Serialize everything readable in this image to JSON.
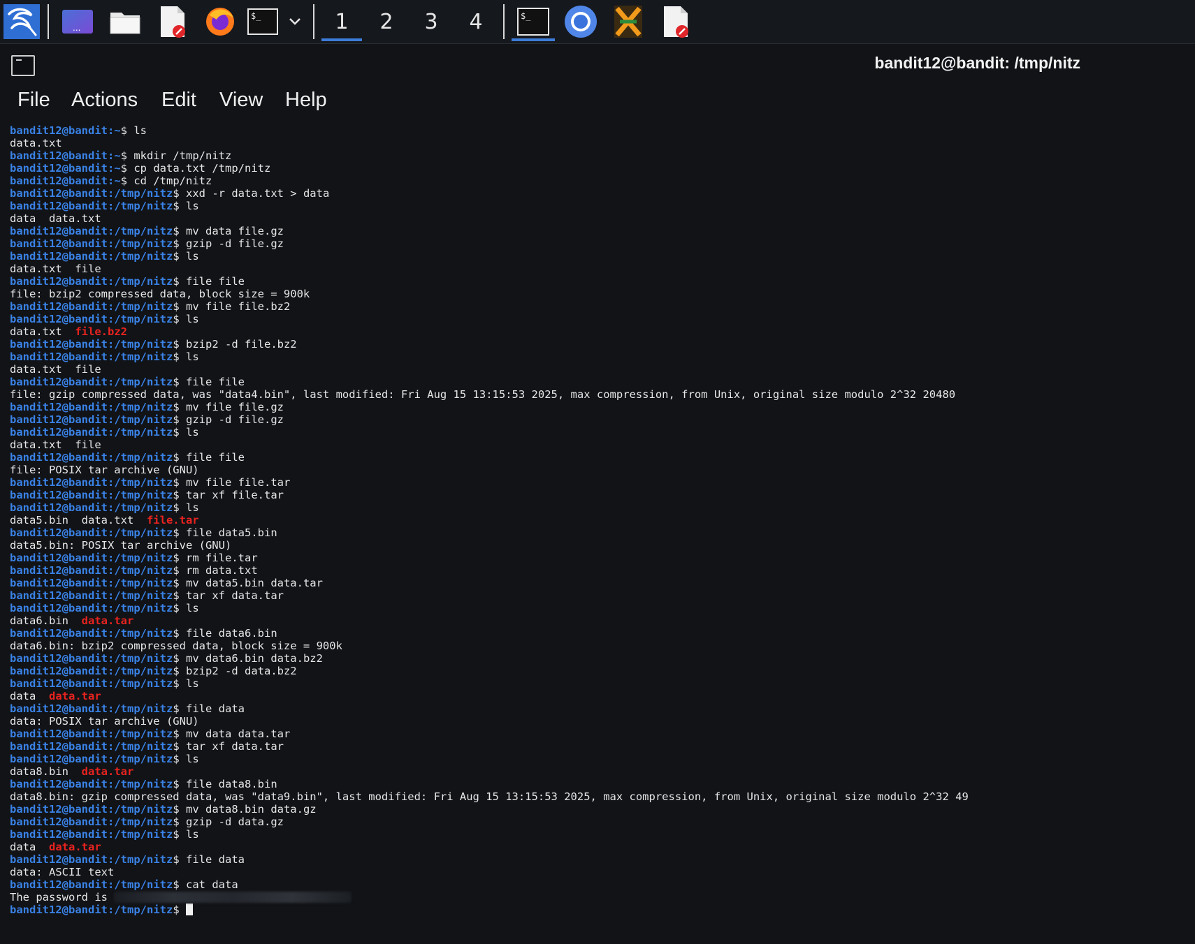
{
  "taskbar": {
    "workspaces": [
      "1",
      "2",
      "3",
      "4"
    ],
    "active_workspace": "1",
    "apps": [
      "kali-menu-icon",
      "desktop-icon",
      "file-manager-icon",
      "text-editor-icon",
      "firefox-icon",
      "terminal-icon",
      "chevron-down-icon",
      "terminal-icon",
      "chromium-icon",
      "burp-icon",
      "text-editor-icon"
    ]
  },
  "window": {
    "title": "bandit12@bandit: /tmp/nitz"
  },
  "menu": {
    "items": [
      "File",
      "Actions",
      "Edit",
      "View",
      "Help"
    ]
  },
  "terminal": {
    "user": "bandit12@bandit",
    "lines": [
      {
        "type": "prompt",
        "path": "~",
        "cmd": "ls"
      },
      {
        "type": "out",
        "text": "data.txt"
      },
      {
        "type": "prompt",
        "path": "~",
        "cmd": "mkdir /tmp/nitz"
      },
      {
        "type": "prompt",
        "path": "~",
        "cmd": "cp data.txt /tmp/nitz"
      },
      {
        "type": "prompt",
        "path": "~",
        "cmd": "cd /tmp/nitz"
      },
      {
        "type": "prompt",
        "path": "/tmp/nitz",
        "cmd": "xxd -r data.txt > data"
      },
      {
        "type": "prompt",
        "path": "/tmp/nitz",
        "cmd": "ls"
      },
      {
        "type": "out",
        "text": "data  data.txt"
      },
      {
        "type": "prompt",
        "path": "/tmp/nitz",
        "cmd": "mv data file.gz"
      },
      {
        "type": "prompt",
        "path": "/tmp/nitz",
        "cmd": "gzip -d file.gz"
      },
      {
        "type": "prompt",
        "path": "/tmp/nitz",
        "cmd": "ls"
      },
      {
        "type": "out",
        "text": "data.txt  file"
      },
      {
        "type": "prompt",
        "path": "/tmp/nitz",
        "cmd": "file file"
      },
      {
        "type": "out",
        "text": "file: bzip2 compressed data, block size = 900k"
      },
      {
        "type": "prompt",
        "path": "/tmp/nitz",
        "cmd": "mv file file.bz2"
      },
      {
        "type": "prompt",
        "path": "/tmp/nitz",
        "cmd": "ls"
      },
      {
        "type": "ls",
        "plain": "data.txt  ",
        "archive": "file.bz2"
      },
      {
        "type": "prompt",
        "path": "/tmp/nitz",
        "cmd": "bzip2 -d file.bz2"
      },
      {
        "type": "prompt",
        "path": "/tmp/nitz",
        "cmd": "ls"
      },
      {
        "type": "out",
        "text": "data.txt  file"
      },
      {
        "type": "prompt",
        "path": "/tmp/nitz",
        "cmd": "file file"
      },
      {
        "type": "out",
        "text": "file: gzip compressed data, was \"data4.bin\", last modified: Fri Aug 15 13:15:53 2025, max compression, from Unix, original size modulo 2^32 20480"
      },
      {
        "type": "prompt",
        "path": "/tmp/nitz",
        "cmd": "mv file file.gz"
      },
      {
        "type": "prompt",
        "path": "/tmp/nitz",
        "cmd": "gzip -d file.gz"
      },
      {
        "type": "prompt",
        "path": "/tmp/nitz",
        "cmd": "ls"
      },
      {
        "type": "out",
        "text": "data.txt  file"
      },
      {
        "type": "prompt",
        "path": "/tmp/nitz",
        "cmd": "file file"
      },
      {
        "type": "out",
        "text": "file: POSIX tar archive (GNU)"
      },
      {
        "type": "prompt",
        "path": "/tmp/nitz",
        "cmd": "mv file file.tar"
      },
      {
        "type": "prompt",
        "path": "/tmp/nitz",
        "cmd": "tar xf file.tar"
      },
      {
        "type": "prompt",
        "path": "/tmp/nitz",
        "cmd": "ls"
      },
      {
        "type": "ls",
        "plain": "data5.bin  data.txt  ",
        "archive": "file.tar"
      },
      {
        "type": "prompt",
        "path": "/tmp/nitz",
        "cmd": "file data5.bin"
      },
      {
        "type": "out",
        "text": "data5.bin: POSIX tar archive (GNU)"
      },
      {
        "type": "prompt",
        "path": "/tmp/nitz",
        "cmd": "rm file.tar"
      },
      {
        "type": "prompt",
        "path": "/tmp/nitz",
        "cmd": "rm data.txt"
      },
      {
        "type": "prompt",
        "path": "/tmp/nitz",
        "cmd": "mv data5.bin data.tar"
      },
      {
        "type": "prompt",
        "path": "/tmp/nitz",
        "cmd": "tar xf data.tar"
      },
      {
        "type": "prompt",
        "path": "/tmp/nitz",
        "cmd": "ls"
      },
      {
        "type": "ls",
        "plain": "data6.bin  ",
        "archive": "data.tar"
      },
      {
        "type": "prompt",
        "path": "/tmp/nitz",
        "cmd": "file data6.bin"
      },
      {
        "type": "out",
        "text": "data6.bin: bzip2 compressed data, block size = 900k"
      },
      {
        "type": "prompt",
        "path": "/tmp/nitz",
        "cmd": "mv data6.bin data.bz2"
      },
      {
        "type": "prompt",
        "path": "/tmp/nitz",
        "cmd": "bzip2 -d data.bz2"
      },
      {
        "type": "prompt",
        "path": "/tmp/nitz",
        "cmd": "ls"
      },
      {
        "type": "ls",
        "plain": "data  ",
        "archive": "data.tar"
      },
      {
        "type": "prompt",
        "path": "/tmp/nitz",
        "cmd": "file data"
      },
      {
        "type": "out",
        "text": "data: POSIX tar archive (GNU)"
      },
      {
        "type": "prompt",
        "path": "/tmp/nitz",
        "cmd": "mv data data.tar"
      },
      {
        "type": "prompt",
        "path": "/tmp/nitz",
        "cmd": "tar xf data.tar"
      },
      {
        "type": "prompt",
        "path": "/tmp/nitz",
        "cmd": "ls"
      },
      {
        "type": "ls",
        "plain": "data8.bin  ",
        "archive": "data.tar"
      },
      {
        "type": "prompt",
        "path": "/tmp/nitz",
        "cmd": "file data8.bin"
      },
      {
        "type": "out",
        "text": "data8.bin: gzip compressed data, was \"data9.bin\", last modified: Fri Aug 15 13:15:53 2025, max compression, from Unix, original size modulo 2^32 49"
      },
      {
        "type": "prompt",
        "path": "/tmp/nitz",
        "cmd": "mv data8.bin data.gz"
      },
      {
        "type": "prompt",
        "path": "/tmp/nitz",
        "cmd": "gzip -d data.gz"
      },
      {
        "type": "prompt",
        "path": "/tmp/nitz",
        "cmd": "ls"
      },
      {
        "type": "ls",
        "plain": "data  ",
        "archive": "data.tar"
      },
      {
        "type": "prompt",
        "path": "/tmp/nitz",
        "cmd": "file data"
      },
      {
        "type": "out",
        "text": "data: ASCII text"
      },
      {
        "type": "prompt",
        "path": "/tmp/nitz",
        "cmd": "cat data"
      },
      {
        "type": "password",
        "text": "The password is "
      },
      {
        "type": "cursor",
        "path": "/tmp/nitz"
      }
    ]
  },
  "colors": {
    "prompt": "#3a82e6",
    "archive": "#e8231f",
    "text": "#e6e6e6",
    "background": "#111317",
    "accent": "#3d7bd8"
  }
}
